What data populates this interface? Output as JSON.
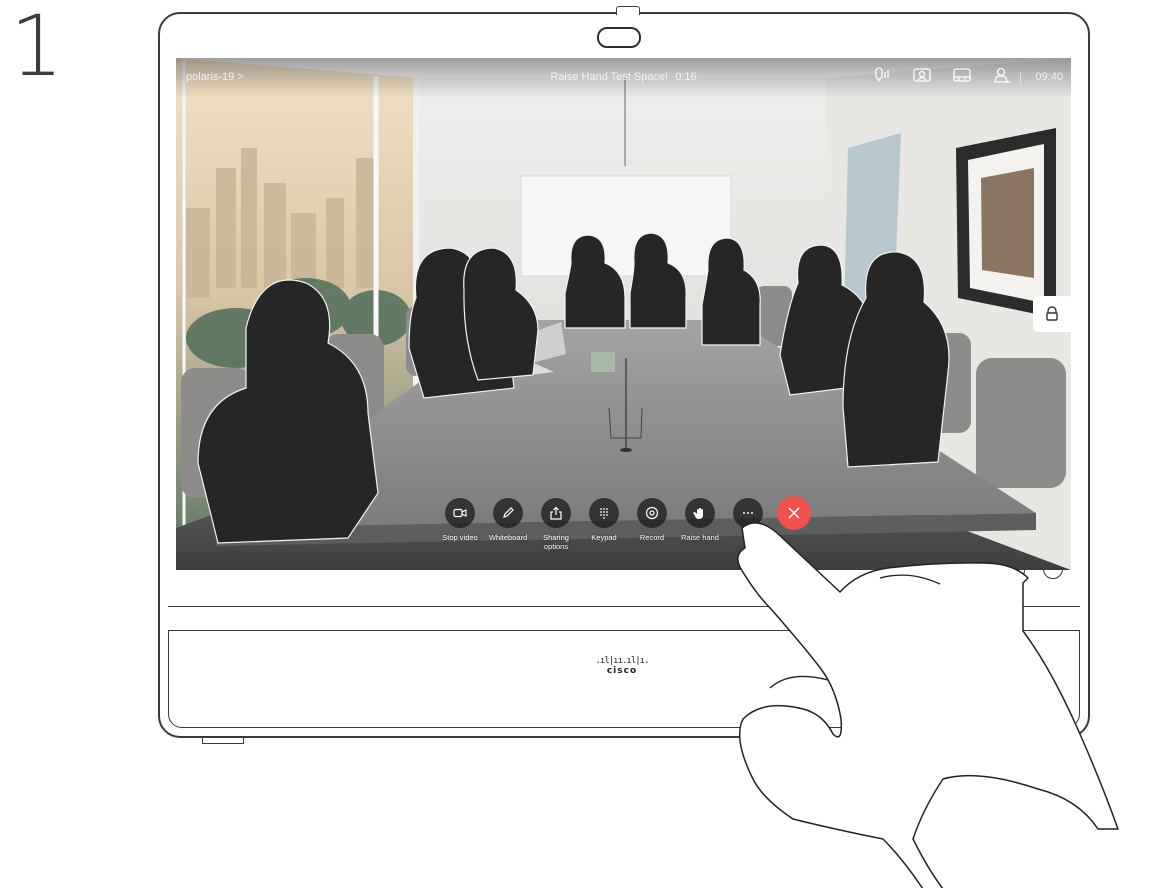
{
  "step_number": "1",
  "call": {
    "participant": "polaris-19 >",
    "title": "Raise Hand Test Space!",
    "duration": "0:16",
    "clock": "09:40"
  },
  "status_icons": [
    "mic-level-icon",
    "self-view-icon",
    "layout-icon",
    "participants-icon"
  ],
  "controls": [
    {
      "key": "stop_video",
      "label": "Stop video",
      "icon": "video-camera-icon"
    },
    {
      "key": "whiteboard",
      "label": "Whiteboard",
      "icon": "pencil-icon"
    },
    {
      "key": "sharing",
      "label": "Sharing options",
      "icon": "share-icon"
    },
    {
      "key": "keypad",
      "label": "Keypad",
      "icon": "keypad-icon"
    },
    {
      "key": "record",
      "label": "Record",
      "icon": "record-icon"
    },
    {
      "key": "raise_hand",
      "label": "Raise hand",
      "icon": "hand-icon"
    },
    {
      "key": "more",
      "label": "",
      "icon": "more-dots-icon"
    },
    {
      "key": "end_call",
      "label": "",
      "icon": "close-icon"
    }
  ],
  "colors": {
    "end_call": "#f0534b",
    "control_bg": "#1e1e1e",
    "screen_wall": "#e6e4e1",
    "table": "#8a8a8a"
  },
  "brand": "cisco"
}
